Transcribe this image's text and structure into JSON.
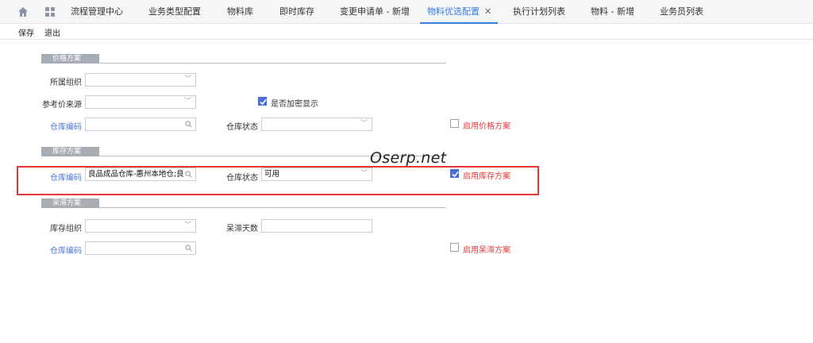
{
  "tabs": [
    {
      "label": "流程管理中心"
    },
    {
      "label": "业务类型配置"
    },
    {
      "label": "物料库"
    },
    {
      "label": "即时库存"
    },
    {
      "label": "变更申请单 - 新增"
    },
    {
      "label": "物料优选配置",
      "close": "✕"
    },
    {
      "label": "执行计划列表"
    },
    {
      "label": "物料 - 新增"
    },
    {
      "label": "业务员列表"
    }
  ],
  "toolbar": {
    "save": "保存",
    "exit": "退出"
  },
  "price_section": {
    "title": "价格方案",
    "org_label": "所属组织",
    "org_value": "",
    "refsrc_label": "参考价来源",
    "refsrc_value": "",
    "encrypt_label": "是否加密显示",
    "encrypt_checked": true,
    "wh_code_label": "仓库编码",
    "wh_code_value": "",
    "wh_status_label": "仓库状态",
    "wh_status_value": "",
    "enable_label": "启用价格方案",
    "enable_checked": false
  },
  "stock_section": {
    "title": "库存方案",
    "wh_code_label": "仓库编码",
    "wh_code_value": "良品成品仓库-惠州本地仓;良",
    "wh_status_label": "仓库状态",
    "wh_status_value": "可用",
    "enable_label": "启用库存方案",
    "enable_checked": true
  },
  "stale_section": {
    "title": "呆滞方案",
    "org_label": "库存组织",
    "org_value": "",
    "days_label": "呆滞天数",
    "days_value": "",
    "wh_code_label": "仓库编码",
    "wh_code_value": "",
    "enable_label": "启用呆滞方案",
    "enable_checked": false
  },
  "watermark": "Oserp.net",
  "colors": {
    "accent": "#3b7be0",
    "link": "#4a76d8",
    "warn": "#e4393c",
    "highlight": "#e53935",
    "check": "#4b6fd8"
  }
}
